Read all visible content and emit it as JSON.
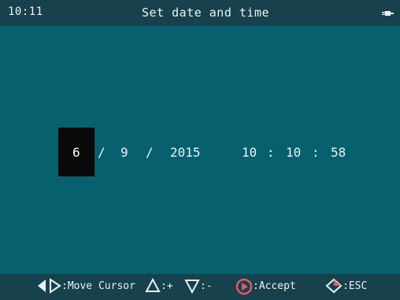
{
  "status_bar": {
    "time": "10:11",
    "title": "Set date and time",
    "power_icon": "plug-icon"
  },
  "datetime": {
    "day": "6",
    "sep1": "/",
    "month": "9",
    "sep2": "/",
    "year": "2015",
    "hour": "10",
    "colon1": ":",
    "minute": "10",
    "colon2": ":",
    "second": "58",
    "selected_field": "day"
  },
  "help_bar": {
    "move_icon": "left-right-diamond-icon",
    "move_label": ":Move Cursor",
    "increase_icon": "triangle-up-icon",
    "increase_label": ":+",
    "decrease_icon": "triangle-down-icon",
    "decrease_label": ":-",
    "accept_icon": "play-circle-icon",
    "accept_label": ":Accept",
    "esc_icon": "diamond-icon",
    "esc_label": ":ESC"
  },
  "colors": {
    "background": "#06606e",
    "bar": "#17414c",
    "text": "#e8f4f6",
    "cursor": "#0a0a0a",
    "accept": "#e05a6a"
  }
}
